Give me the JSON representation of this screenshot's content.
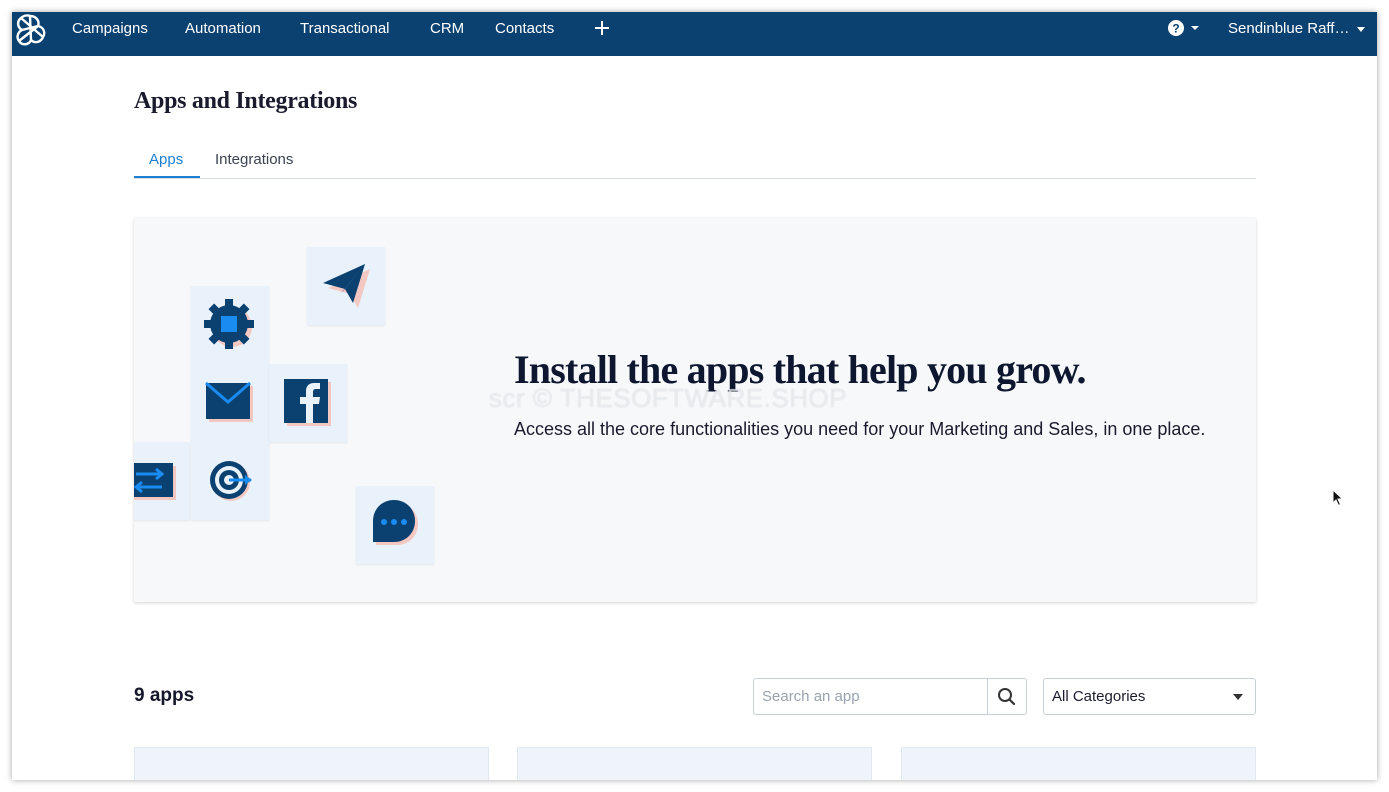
{
  "nav": {
    "items": [
      "Campaigns",
      "Automation",
      "Transactional",
      "CRM",
      "Contacts"
    ],
    "account_label": "Sendinblue Raff…"
  },
  "page": {
    "title": "Apps and Integrations"
  },
  "tabs": [
    {
      "label": "Apps",
      "active": true
    },
    {
      "label": "Integrations",
      "active": false
    }
  ],
  "hero": {
    "heading": "Install the apps that help you grow.",
    "text": "Access all the core functionalities you need for your Marketing and Sales, in one place.",
    "watermark": "scr © THESOFTWARE.SHOP"
  },
  "apps": {
    "count_label": "9 apps",
    "search_placeholder": "Search an app",
    "category_selected": "All Categories"
  },
  "colors": {
    "nav_bg": "#0b4170",
    "accent": "#1f7fd0",
    "icon_dark": "#0b4170",
    "icon_blue": "#1a8bf0",
    "icon_shadow": "#f3c7c2"
  },
  "icons": [
    "sendinblue-logo-icon",
    "plus-icon",
    "help-icon",
    "gear-icon",
    "paper-plane-icon",
    "envelope-icon",
    "facebook-icon",
    "sync-icon",
    "target-icon",
    "chat-bubble-icon",
    "search-icon",
    "chevron-down-icon",
    "mouse-cursor-icon"
  ]
}
